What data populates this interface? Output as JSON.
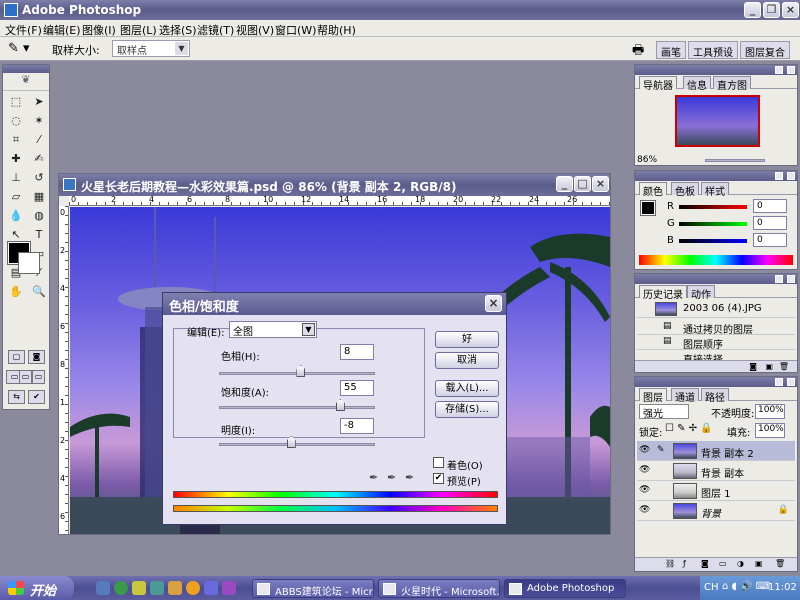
{
  "app": {
    "title": "Adobe Photoshop"
  },
  "menu": [
    "文件(F)",
    "编辑(E)",
    "图像(I)",
    "图层(L)",
    "选择(S)",
    "滤镜(T)",
    "视图(V)",
    "窗口(W)",
    "帮助(H)"
  ],
  "options": {
    "sample_label": "取样大小:",
    "sample_value": "取样点",
    "wells": [
      "画笔",
      "工具预设",
      "图层复合"
    ]
  },
  "document": {
    "title": "火星长老后期教程—水彩效果篇.psd @ 86% (背景 副本 2, RGB/8)",
    "ruler_h": [
      "0",
      "2",
      "4",
      "6",
      "8",
      "10",
      "12",
      "14",
      "16",
      "18",
      "20",
      "22",
      "24",
      "26"
    ],
    "ruler_v": [
      "0",
      "2",
      "4",
      "6",
      "8",
      "1",
      "2",
      "4",
      "6"
    ]
  },
  "dialog": {
    "title": "色相/饱和度",
    "edit_label": "编辑(E):",
    "edit_value": "全图",
    "hue_label": "色相(H):",
    "hue_value": "8",
    "hue": 8,
    "sat_label": "饱和度(A):",
    "sat_value": "55",
    "saturation": 55,
    "light_label": "明度(I):",
    "light_value": "-8",
    "lightness": -8,
    "buttons": {
      "ok": "好",
      "cancel": "取消",
      "load": "载入(L)...",
      "save": "存储(S)..."
    },
    "colorize": "着色(O)",
    "preview": "预览(P)",
    "preview_checked": true
  },
  "navigator": {
    "tabs": [
      "导航器",
      "信息",
      "直方图"
    ],
    "zoom": "86%"
  },
  "color": {
    "tabs": [
      "颜色",
      "色板",
      "样式"
    ],
    "r": "0",
    "g": "0",
    "b": "0",
    "r_label": "R",
    "g_label": "G",
    "b_label": "B"
  },
  "history": {
    "tabs": [
      "历史记录",
      "动作"
    ],
    "snapshot": "2003 06 (4).JPG",
    "items": [
      "通过拷贝的图层",
      "图层顺序",
      "直接选择"
    ]
  },
  "layers": {
    "tabs": [
      "图层",
      "通道",
      "路径"
    ],
    "blend_mode": "强光",
    "opacity_label": "不透明度:",
    "opacity": "100%",
    "lock_label": "锁定:",
    "fill_label": "填充:",
    "fill": "100%",
    "items": [
      "背景 副本 2",
      "背景 副本",
      "图层 1",
      "背景"
    ]
  },
  "taskbar": {
    "start": "开始",
    "items": [
      "ABBS建筑论坛 - Micr...",
      "火星时代 - Microsoft...",
      "Adobe Photoshop"
    ],
    "lang": "CH",
    "clock": "11:02"
  },
  "colors": {
    "titlebar": "#5b5c8a",
    "taskbar": "#4c4e92"
  }
}
